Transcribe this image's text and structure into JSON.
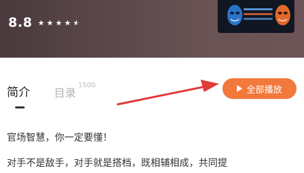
{
  "header": {
    "rating": "8.8",
    "stars_value": 4.5,
    "stars_max": 5
  },
  "tabs": {
    "intro_label": "简介",
    "catalog_label": "目录",
    "catalog_count": "1500"
  },
  "actions": {
    "play_all_label": "全部播放"
  },
  "description": {
    "line1": "官场智慧，你一定要懂！",
    "line2": "对手不是敌手，对手就是搭档，既相辅相成，共同提"
  },
  "colors": {
    "accent": "#f2783c",
    "annotation_arrow": "#e03a3a"
  }
}
